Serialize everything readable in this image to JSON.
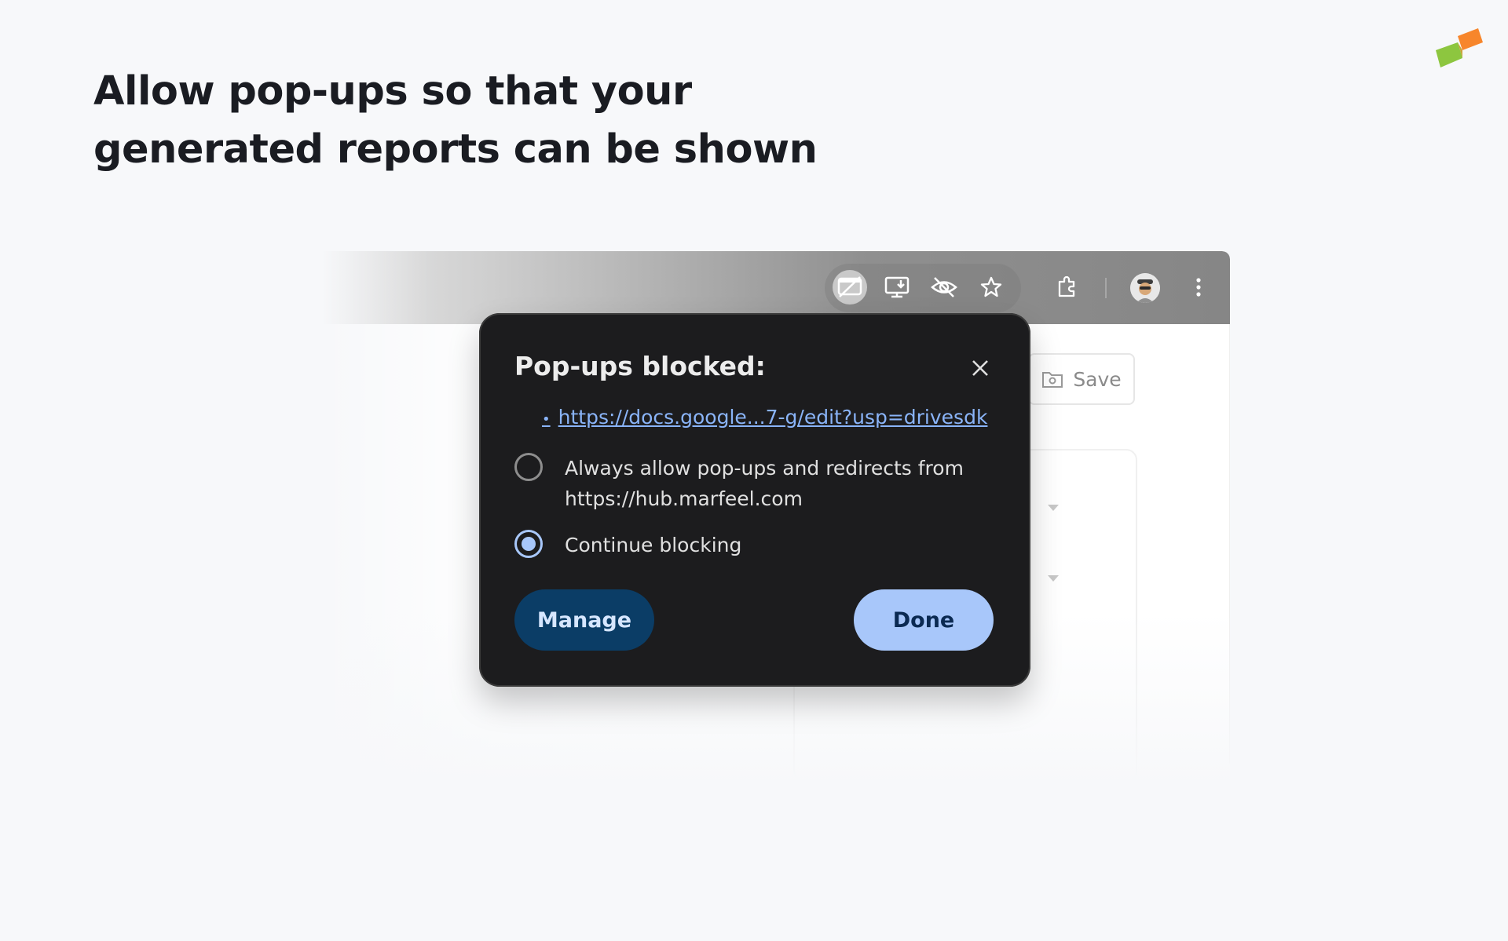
{
  "headline": {
    "line1": "Allow pop-ups so that your",
    "line2": "generated reports can be shown"
  },
  "brand": {
    "logo_icon": "marfeel-logo-icon",
    "colors": {
      "orange": "#f7862b",
      "green": "#8dc63f"
    }
  },
  "browser": {
    "toolbar_icons": [
      "popup-blocked-icon",
      "install-app-icon",
      "hide-icon",
      "bookmark-star-icon",
      "extensions-icon",
      "avatar",
      "more-menu-icon"
    ],
    "page": {
      "save_label": "Save"
    }
  },
  "popup": {
    "title": "Pop-ups blocked:",
    "blocked_url": "https://docs.google...7-g/edit?usp=drivesdk",
    "options": [
      {
        "label": "Always allow pop-ups and redirects from https://hub.marfeel.com",
        "selected": false
      },
      {
        "label": "Continue blocking",
        "selected": true
      }
    ],
    "manage_label": "Manage",
    "done_label": "Done",
    "colors": {
      "background": "#1c1c1e",
      "accent": "#a8c7fa",
      "manage_bg": "#0b3d66"
    }
  }
}
